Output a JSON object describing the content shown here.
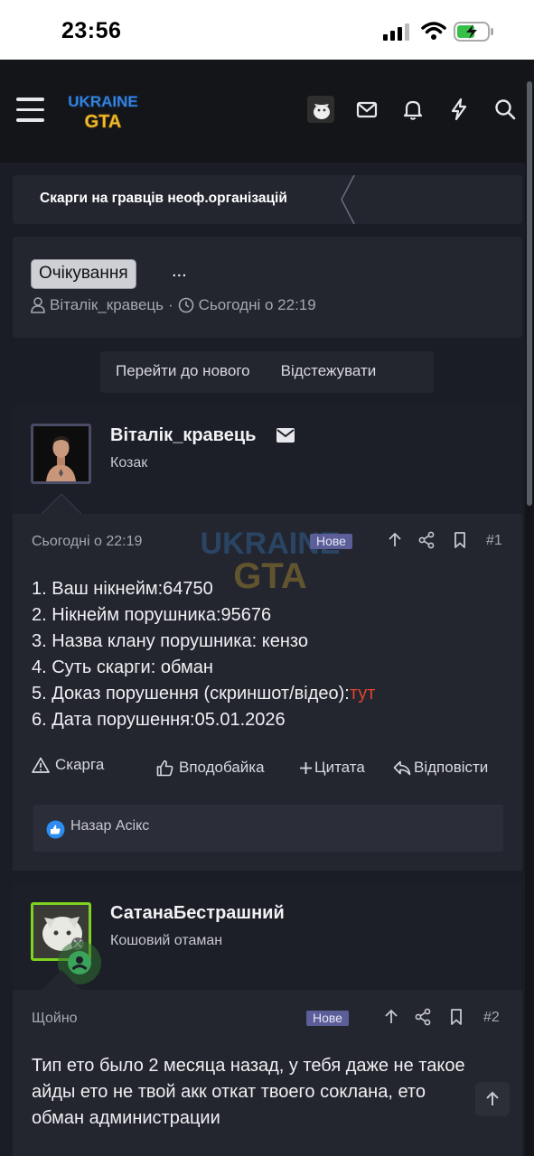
{
  "status_bar": {
    "time": "23:56"
  },
  "header": {
    "logo_line1": "UKRAINE",
    "logo_line2": "GTA",
    "icons": [
      "menu-icon",
      "mail-icon",
      "bell-icon",
      "bolt-icon",
      "search-icon"
    ]
  },
  "breadcrumb": {
    "label": "Скарги на гравців неоф.організацій"
  },
  "thread": {
    "prefix": "Очікування",
    "title": "...",
    "author": "Віталік_кравець",
    "separator": "·",
    "date": "Сьогодні о 22:19"
  },
  "thread_buttons": {
    "goto_new": "Перейти до нового",
    "watch": "Відстежувати"
  },
  "posts": [
    {
      "author": "Віталік_кравець",
      "user_title": "Козак",
      "date": "Сьогодні о 22:19",
      "badge": "Нове",
      "number": "#1",
      "lines": [
        "1. Ваш нікнейм:64750",
        "2. Нікнейм порушника:95676",
        "3. Назва клану порушника: кензо",
        "4. Суть скарги: обман",
        "5. Доказ порушення (скриншот/відео):",
        "6. Дата порушення:05.01.2026"
      ],
      "link_text": "тут",
      "actions": {
        "report": "Скарга",
        "like": "Вподобайка",
        "quote": "Цитата",
        "reply": "Відповісти"
      },
      "likes": "Назар Асікс"
    },
    {
      "author": "СатанаБестрашний",
      "user_title": "Кошовий отаман",
      "date": "Щойно",
      "badge": "Нове",
      "number": "#2",
      "lines": [
        "Тип ето было 2 месяца назад, у тебя даже не такое",
        "айды ето не твой акк откат твоего соклана, ето",
        "обман администрации"
      ]
    }
  ],
  "colors": {
    "background": "#1b1d26",
    "panel": "#23252f",
    "accent_badge": "#5b5e98",
    "link": "#e0442e",
    "online": "#3aa55a"
  }
}
